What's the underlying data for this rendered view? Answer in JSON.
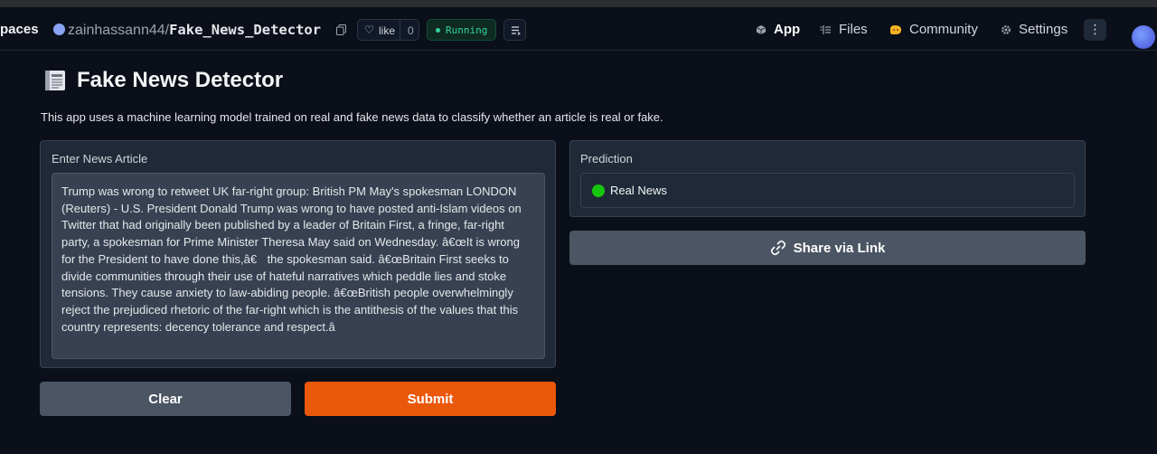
{
  "header": {
    "brand": "paces",
    "owner": "zainhassann44",
    "separator": "/",
    "repo": "Fake_News_Detector",
    "like_label": "like",
    "like_count": "0",
    "status": "Running",
    "status_color": "#34d399",
    "nav": [
      {
        "label": "App",
        "icon": "cube-icon",
        "active": true
      },
      {
        "label": "Files",
        "icon": "files-icon",
        "active": false
      },
      {
        "label": "Community",
        "icon": "community-icon",
        "active": false
      },
      {
        "label": "Settings",
        "icon": "gear-icon",
        "active": false
      }
    ],
    "more_label": "⋮"
  },
  "app": {
    "title": "Fake News Detector",
    "title_icon": "newspaper-icon",
    "description": "This app uses a machine learning model trained on real and fake news data to classify whether an article is real or fake.",
    "input": {
      "label": "Enter News Article",
      "value": "Trump was wrong to retweet UK far-right group: British PM May's spokesman LONDON (Reuters) - U.S. President Donald Trump was wrong to have posted anti-Islam videos on Twitter that had originally been published by a leader of Britain First, a fringe, far-right party, a spokesman for Prime Minister Theresa May said on Wednesday. â€œIt is wrong for the President to have done this,â€ the spokesman said. â€œBritain First seeks to divide communities through their use of hateful narratives which peddle lies and stoke tensions. They cause anxiety to law-abiding people.  â€œBritish people overwhelmingly reject the prejudiced rhetoric of the far-right which is the antithesis of the values that this country represents: decency tolerance and respect.â"
    },
    "output": {
      "label": "Prediction",
      "value": "Real News",
      "indicator_color": "#16c60c"
    },
    "share_label": "Share via Link",
    "share_icon": "link-icon",
    "clear_label": "Clear",
    "submit_label": "Submit",
    "accent_color": "#ea580c"
  }
}
